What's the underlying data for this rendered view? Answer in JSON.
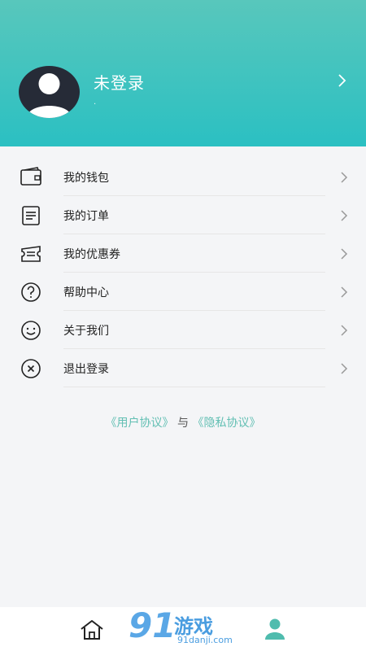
{
  "profile": {
    "name": "未登录",
    "subtitle": "."
  },
  "menu": {
    "items": [
      {
        "label": "我的钱包",
        "icon": "wallet-icon"
      },
      {
        "label": "我的订单",
        "icon": "order-list-icon"
      },
      {
        "label": "我的优惠券",
        "icon": "coupon-icon"
      },
      {
        "label": "帮助中心",
        "icon": "help-circle-icon"
      },
      {
        "label": "关于我们",
        "icon": "smile-icon"
      },
      {
        "label": "退出登录",
        "icon": "close-circle-icon"
      }
    ]
  },
  "agreements": {
    "user_agreement": "《用户协议》",
    "conjunction": "与",
    "privacy_policy": "《隐私协议》"
  },
  "tabbar": {
    "items": [
      {
        "icon": "home-icon",
        "active": false
      },
      {
        "icon": "person-icon",
        "active": true
      }
    ],
    "active_color": "#4fbcae"
  },
  "watermark": {
    "number": "91",
    "word": "游戏",
    "domain": "91danji.com"
  },
  "colors": {
    "header_gradient_top": "#58c7bc",
    "header_gradient_bottom": "#2bc0c2",
    "link": "#62bfb3"
  }
}
